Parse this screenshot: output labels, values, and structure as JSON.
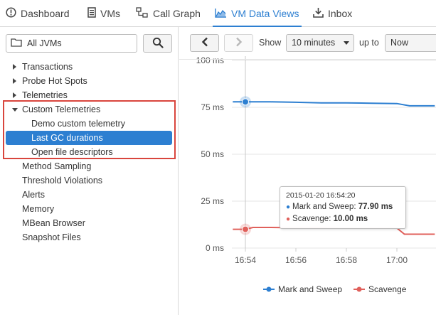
{
  "topnav": {
    "tabs": [
      {
        "label": "Dashboard",
        "icon": "dashboard-icon"
      },
      {
        "label": "VMs",
        "icon": "vms-icon"
      },
      {
        "label": "Call Graph",
        "icon": "call-graph-icon"
      },
      {
        "label": "VM Data Views",
        "icon": "vm-data-views-icon",
        "active": true
      },
      {
        "label": "Inbox",
        "icon": "inbox-icon"
      }
    ]
  },
  "sidebar": {
    "jvm_selector": {
      "value": "All JVMs",
      "icon": "folder-icon"
    },
    "search_icon": "search-icon",
    "items": [
      {
        "label": "Transactions",
        "expander": "collapsed"
      },
      {
        "label": "Probe Hot Spots",
        "expander": "collapsed"
      },
      {
        "label": "Telemetries",
        "expander": "collapsed"
      },
      {
        "label": "Custom Telemetries",
        "expander": "expanded"
      },
      {
        "label": "Demo custom telemetry",
        "child": true
      },
      {
        "label": "Last GC durations",
        "child": true,
        "selected": true
      },
      {
        "label": "Open file descriptors",
        "child": true
      },
      {
        "label": "Method Sampling"
      },
      {
        "label": "Threshold Violations"
      },
      {
        "label": "Alerts"
      },
      {
        "label": "Memory"
      },
      {
        "label": "MBean Browser"
      },
      {
        "label": "Snapshot Files"
      }
    ]
  },
  "toolbar": {
    "show_label": "Show",
    "duration": "10 minutes",
    "upto_label": "up to",
    "upto_value": "Now"
  },
  "chart_data": {
    "type": "line",
    "y_tick_labels": [
      "100 ms",
      "75 ms",
      "50 ms",
      "25 ms",
      "0 ms"
    ],
    "x_tick_labels": [
      "16:54",
      "16:56",
      "16:58",
      "17:00"
    ],
    "ylim": [
      0,
      100
    ],
    "grid": "horizontal",
    "legend_placement": "bottom",
    "series": [
      {
        "name": "Mark and Sweep",
        "color": "#2d7fd1",
        "x": [
          "16:53.5",
          "16:54",
          "16:55",
          "16:56",
          "16:57",
          "16:58",
          "16:59",
          "17:00",
          "17:00.5",
          "17:01",
          "17:01.5"
        ],
        "y": [
          77.9,
          77.9,
          77.9,
          77.7,
          77.4,
          77.4,
          77.2,
          77.0,
          75.8,
          75.8,
          75.8
        ]
      },
      {
        "name": "Scavenge",
        "color": "#e0605b",
        "x": [
          "16:53.5",
          "16:54",
          "16:54.3",
          "16:55",
          "16:56",
          "16:57",
          "16:58",
          "16:59",
          "17:00",
          "17:00.3",
          "17:01",
          "17:01.5"
        ],
        "y": [
          10.0,
          10.0,
          11.0,
          11.0,
          10.8,
          11.0,
          10.6,
          10.6,
          10.7,
          7.4,
          7.4,
          7.4
        ]
      }
    ],
    "crosshair_x": "16:54",
    "tooltip": {
      "time": "2015-01-20 16:54:20",
      "rows": [
        {
          "series": "Mark and Sweep",
          "value": "77.90 ms"
        },
        {
          "series": "Scavenge",
          "value": "10.00 ms"
        }
      ]
    }
  }
}
